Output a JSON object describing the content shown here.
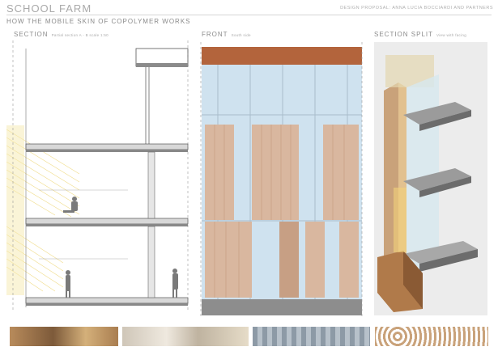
{
  "header": {
    "title": "SCHOOL FARM",
    "subtitle": "DESIGN PROPOSAL: ANNA LUCIA BOCCIARDI AND PARTNERS",
    "heading": "HOW THE MOBILE SKIN OF COPOLYMER WORKS"
  },
  "panels": {
    "section": {
      "label": "SECTION",
      "note": "Partial section A - B  scale 1:50"
    },
    "front": {
      "label": "FRONT",
      "note": "South side"
    },
    "section_split": {
      "label": "SECTION SPLIT",
      "note": "View with facing"
    }
  },
  "colors": {
    "copper": "#b3643c",
    "glass": "#c9dfee",
    "panel": "#d9b79f",
    "dark_panel": "#c79f84",
    "line": "#555555",
    "yellow": "#f0dc8a"
  }
}
